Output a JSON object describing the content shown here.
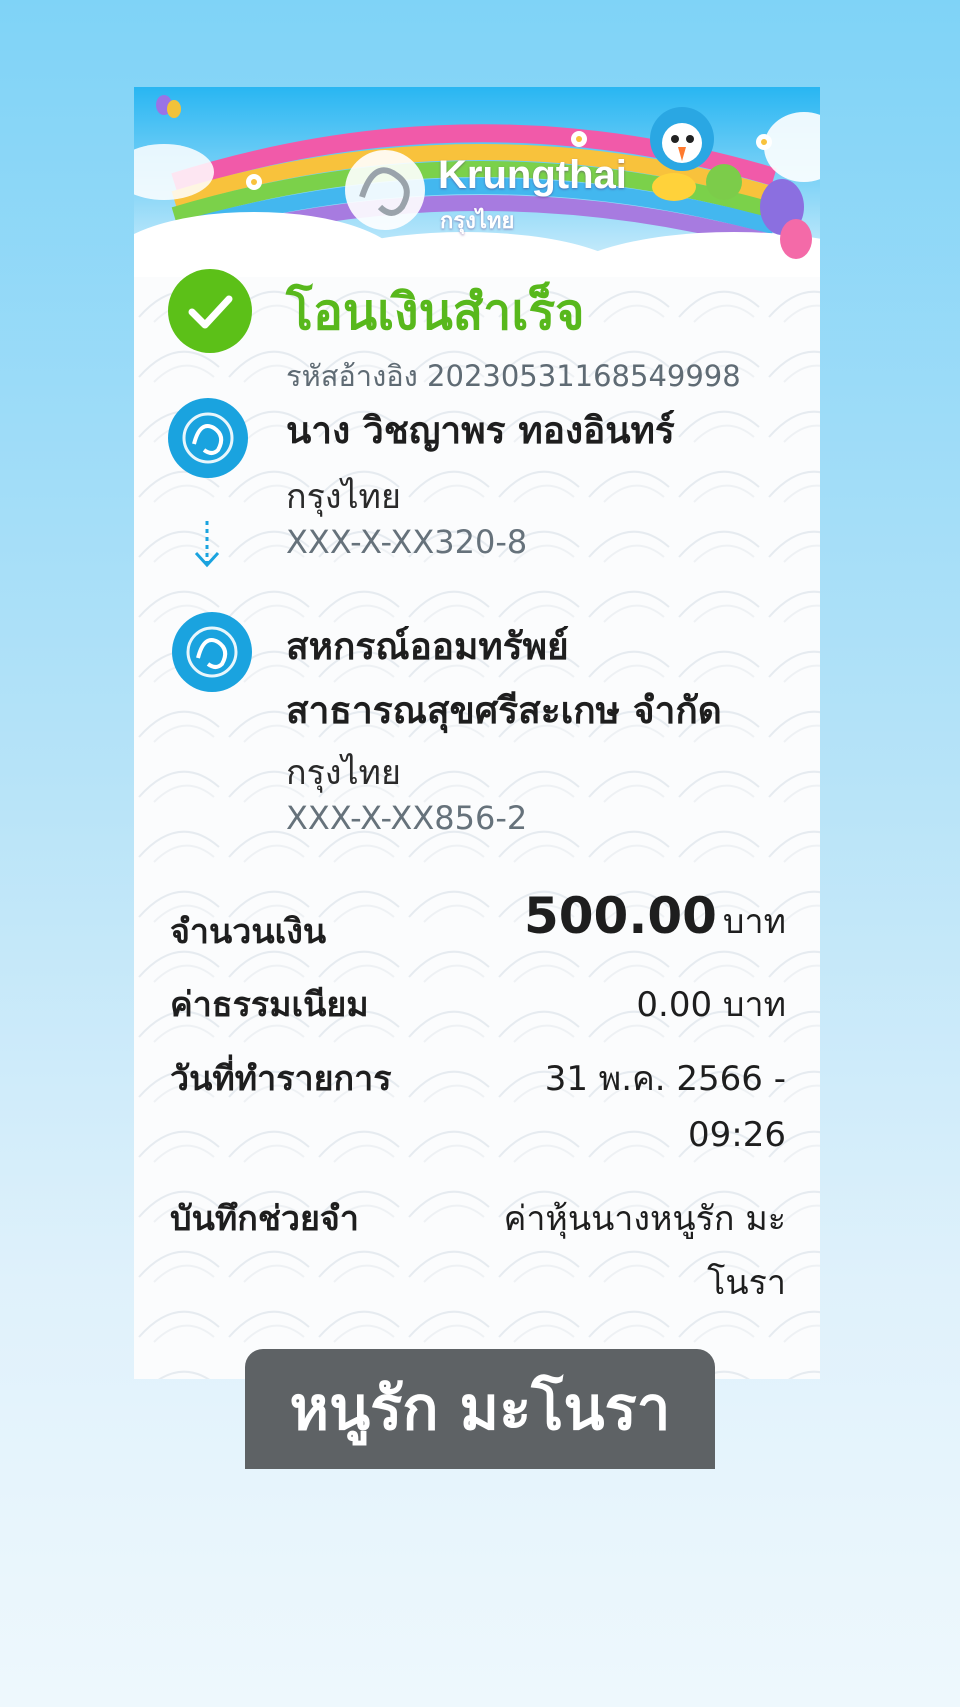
{
  "brand": {
    "name_en": "Krungthai",
    "name_th": "กรุงไทย"
  },
  "status": {
    "title": "โอนเงินสำเร็จ",
    "reference": "รหัสอ้างอิง 20230531168549998"
  },
  "sender": {
    "name": "นาง วิชญาพร ทองอินทร์",
    "bank": "กรุงไทย",
    "account": "XXX-X-XX320-8"
  },
  "receiver": {
    "name_line1": "สหกรณ์ออมทรัพย์",
    "name_line2": "สาธารณสุขศรีสะเกษ จำกัด",
    "bank": "กรุงไทย",
    "account": "XXX-X-XX856-2"
  },
  "details": {
    "amount_label": "จำนวนเงิน",
    "amount_value": "500.00",
    "amount_unit": "บาท",
    "fee_label": "ค่าธรรมเนียม",
    "fee_value": "0.00 บาท",
    "date_label": "วันที่ทำรายการ",
    "date_line1": "31 พ.ค. 2566 -",
    "date_line2": "09:26",
    "memo_label": "บันทึกช่วยจำ",
    "memo_line1": "ค่าหุ้นนางหนูรัก  มะ",
    "memo_line2": "โนรา"
  },
  "caption": "หนูรัก มะโนรา",
  "colors": {
    "success_green": "#58b81c",
    "krungthai_blue": "#1aa3df",
    "caption_bg": "#5e6265"
  },
  "icons": [
    "check-icon",
    "bank-logo-icon",
    "arrow-down-icon",
    "mascot-icon",
    "balloon-icon"
  ]
}
